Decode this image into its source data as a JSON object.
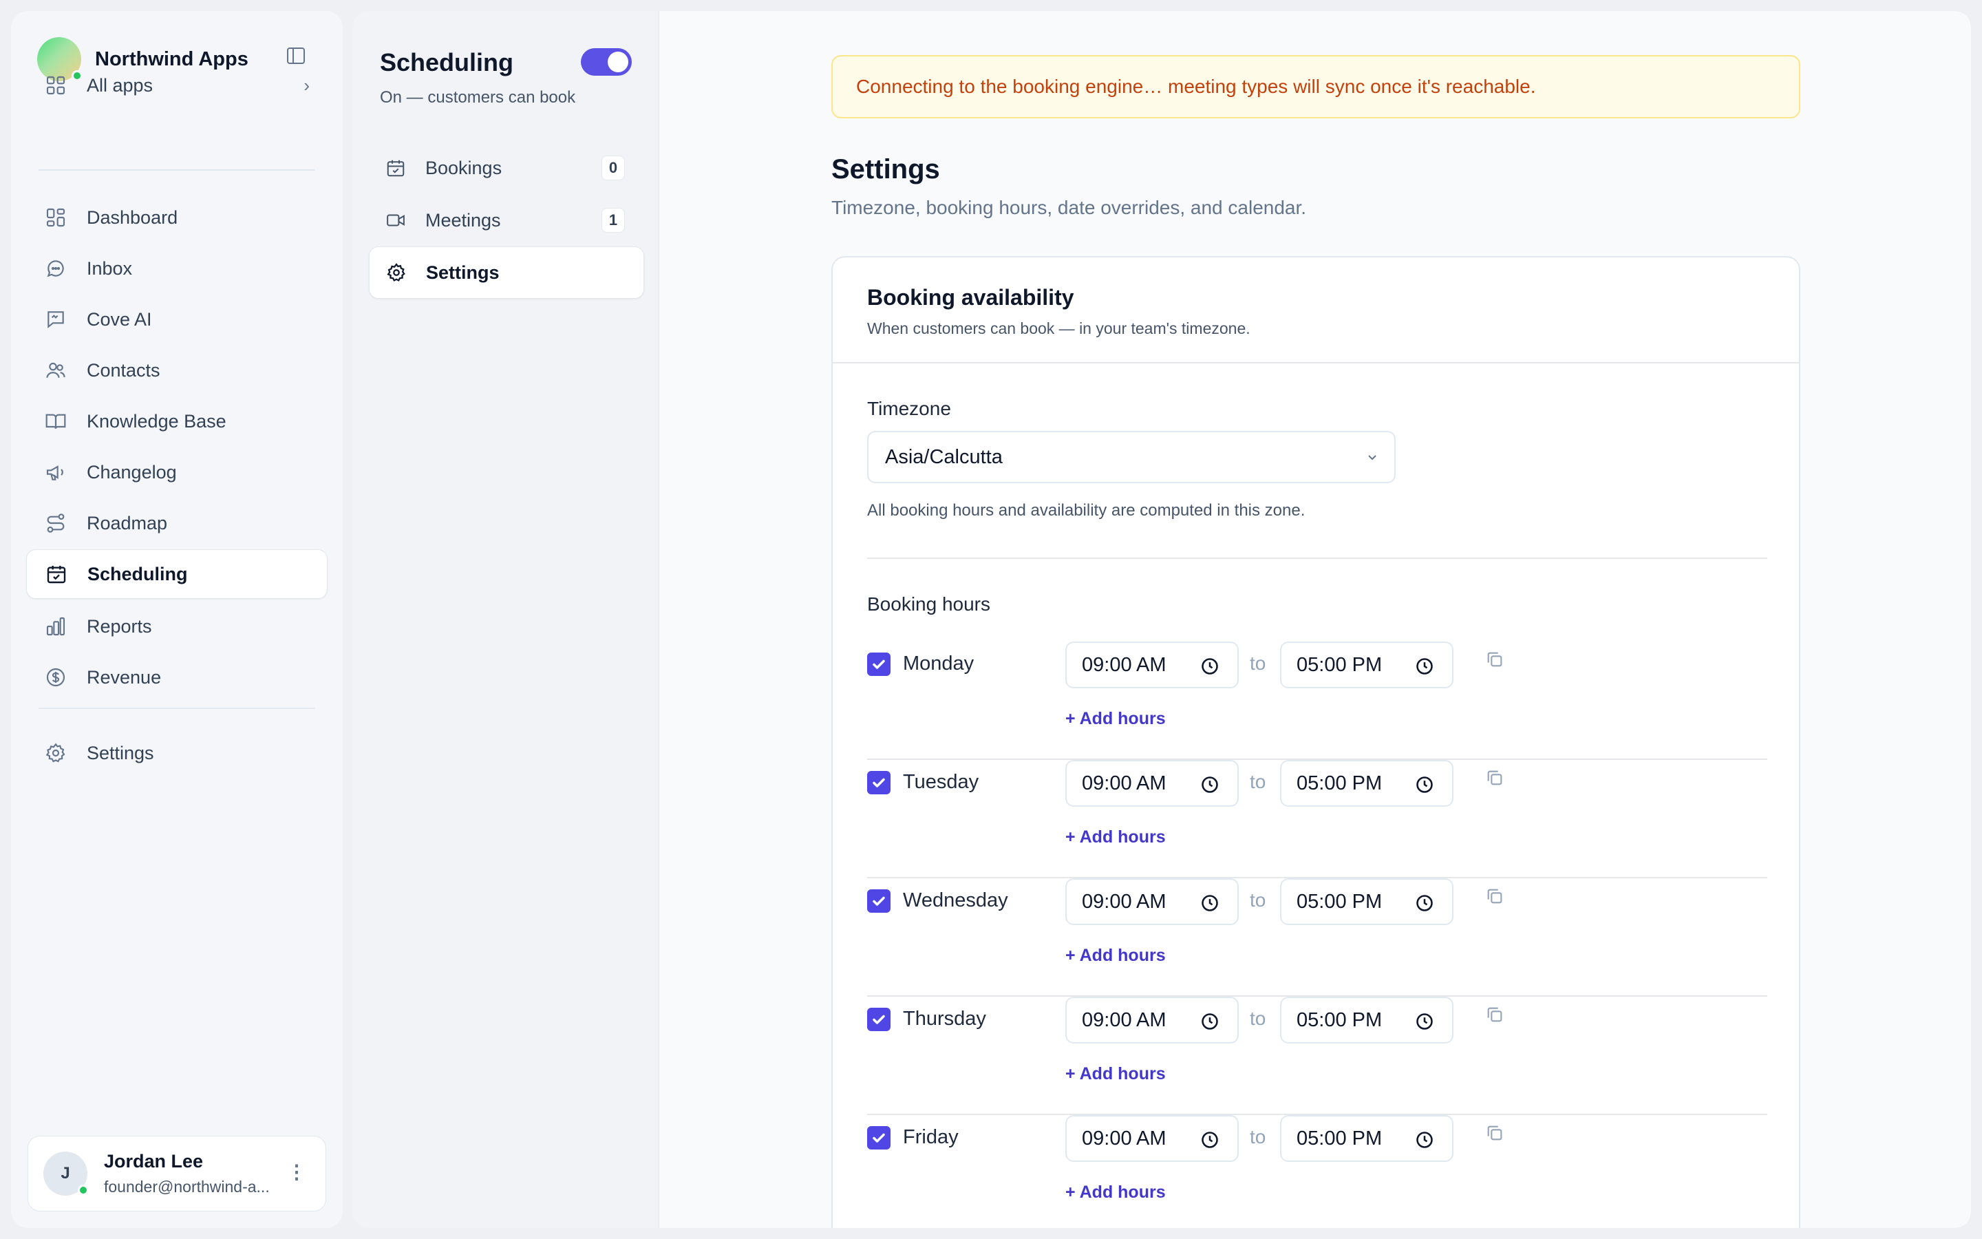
{
  "brand": {
    "name": "Northwind Apps"
  },
  "sidebar": {
    "all_apps": "All apps",
    "items": [
      {
        "label": "Dashboard",
        "icon": "dashboard-icon"
      },
      {
        "label": "Inbox",
        "icon": "chat-icon"
      },
      {
        "label": "Cove AI",
        "icon": "ai-chat-icon"
      },
      {
        "label": "Contacts",
        "icon": "users-icon"
      },
      {
        "label": "Knowledge Base",
        "icon": "book-icon"
      },
      {
        "label": "Changelog",
        "icon": "megaphone-icon"
      },
      {
        "label": "Roadmap",
        "icon": "route-icon"
      },
      {
        "label": "Scheduling",
        "icon": "calendar-check-icon",
        "active": true
      },
      {
        "label": "Reports",
        "icon": "bar-chart-icon"
      },
      {
        "label": "Revenue",
        "icon": "dollar-icon"
      }
    ],
    "settings": "Settings"
  },
  "user": {
    "initial": "J",
    "name": "Jordan Lee",
    "email": "founder@northwind-a..."
  },
  "scheduling": {
    "title": "Scheduling",
    "status": "On — customers can book",
    "enabled": true,
    "items": [
      {
        "label": "Bookings",
        "count": "0"
      },
      {
        "label": "Meetings",
        "count": "1"
      },
      {
        "label": "Settings",
        "active": true
      }
    ]
  },
  "main": {
    "banner": "Connecting to the booking engine… meeting types will sync once it's reachable.",
    "title": "Settings",
    "subtitle": "Timezone, booking hours, date overrides, and calendar.",
    "card": {
      "title": "Booking availability",
      "description": "When customers can book — in your team's timezone.",
      "timezone_label": "Timezone",
      "timezone_value": "Asia/Calcutta",
      "timezone_help": "All booking hours and availability are computed in this zone.",
      "booking_hours_label": "Booking hours",
      "to_label": "to",
      "add_hours_label": "+ Add hours",
      "days": [
        {
          "name": "Monday",
          "checked": true,
          "start": "09:00  AM",
          "end": "05:00  PM"
        },
        {
          "name": "Tuesday",
          "checked": true,
          "start": "09:00  AM",
          "end": "05:00  PM"
        },
        {
          "name": "Wednesday",
          "checked": true,
          "start": "09:00  AM",
          "end": "05:00  PM"
        },
        {
          "name": "Thursday",
          "checked": true,
          "start": "09:00  AM",
          "end": "05:00  PM"
        },
        {
          "name": "Friday",
          "checked": true,
          "start": "09:00  AM",
          "end": "05:00  PM"
        }
      ]
    }
  },
  "colors": {
    "accent": "#4f46e5",
    "banner_bg": "#fefce8",
    "banner_text": "#c2410c",
    "online": "#22c55e"
  }
}
